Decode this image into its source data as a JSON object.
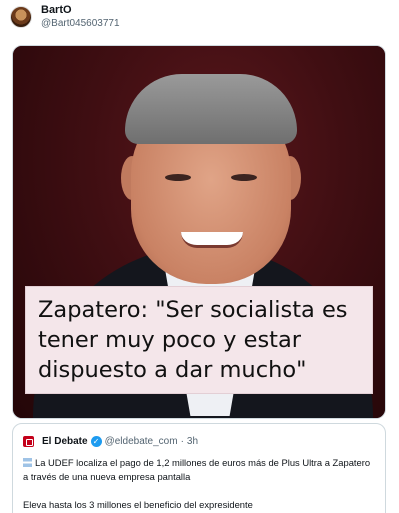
{
  "post": {
    "display_name": "BartO",
    "handle": "@Bart045603771",
    "avatar_icon": "profile-avatar"
  },
  "media": {
    "caption": "Zapatero: \"Ser socialista es tener muy poco y estar dispuesto a dar mucho\""
  },
  "quote": {
    "brand_icon": "el-debate-logo",
    "name": "El Debate",
    "verified_icon": "verified-badge-icon",
    "handle": "@eldebate_com",
    "separator": "·",
    "time": "3h",
    "flag_icon": "argentina-flag-icon",
    "line1": "La UDEF localiza el pago de 1,2 millones de euros más de Plus Ultra a Zapatero a través de una nueva empresa pantalla",
    "line2": "Eleva hasta los 3 millones el beneficio del expresidente"
  },
  "colors": {
    "accent": "#1d9bf0",
    "brand_red": "#c4001a",
    "muted_text": "#536471"
  }
}
